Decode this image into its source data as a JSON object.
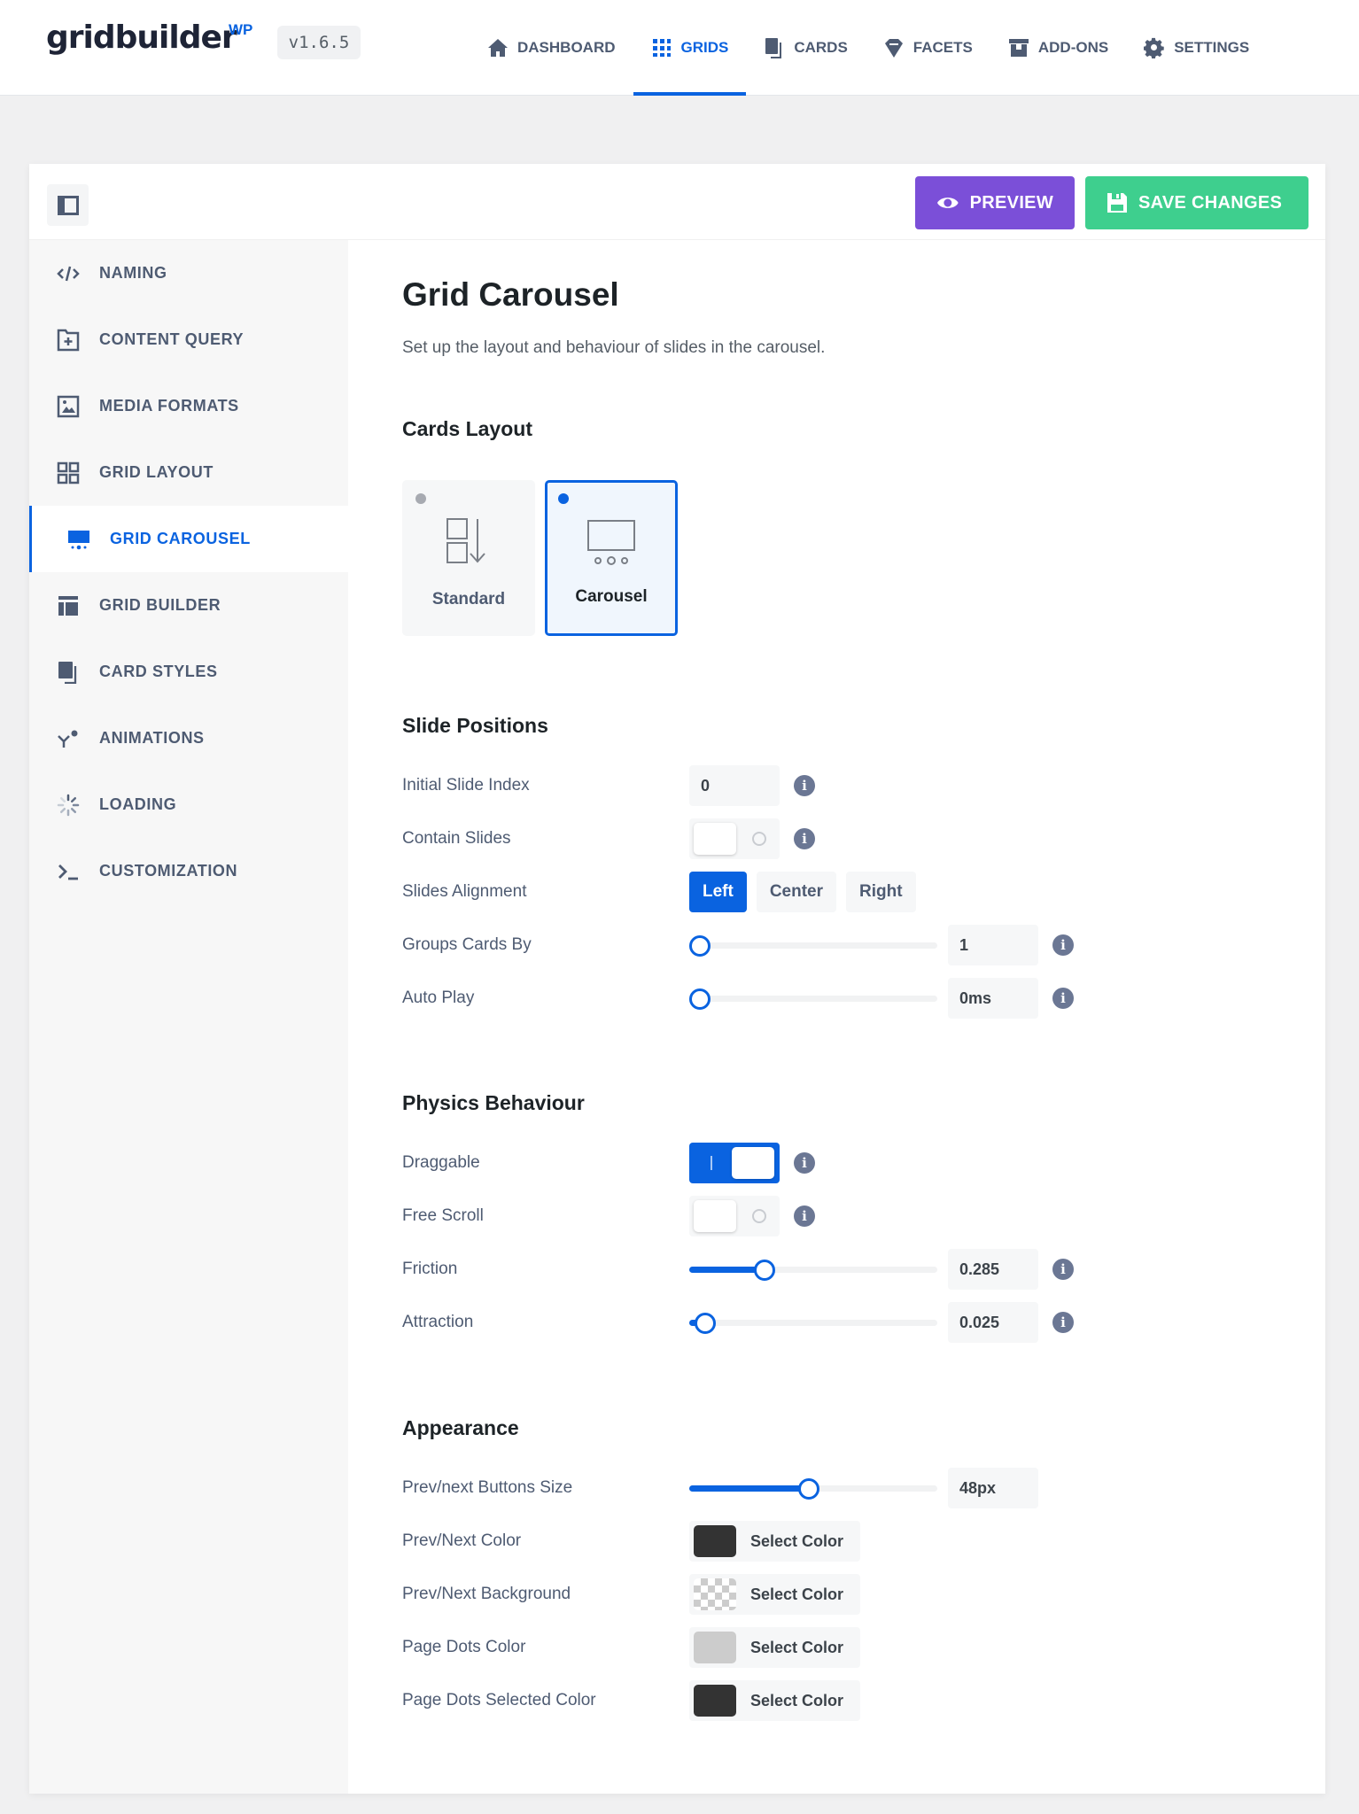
{
  "brand": {
    "logo_text": "gridbuilder",
    "logo_sup": "WP",
    "version": "v1.6.5"
  },
  "nav": [
    {
      "label": "DASHBOARD",
      "icon": "home-icon",
      "active": false
    },
    {
      "label": "GRIDS",
      "icon": "grid-dots-icon",
      "active": true
    },
    {
      "label": "CARDS",
      "icon": "cards-icon",
      "active": false
    },
    {
      "label": "FACETS",
      "icon": "diamond-icon",
      "active": false
    },
    {
      "label": "ADD-ONS",
      "icon": "box-icon",
      "active": false
    },
    {
      "label": "SETTINGS",
      "icon": "gear-icon",
      "active": false
    }
  ],
  "toolbar": {
    "preview_label": "PREVIEW",
    "save_label": "SAVE CHANGES"
  },
  "colors": {
    "accent": "#0a63e0",
    "preview": "#7b4fd8",
    "save": "#3ecf8e"
  },
  "sidebar": {
    "items": [
      {
        "label": "NAMING",
        "icon": "code-icon"
      },
      {
        "label": "CONTENT QUERY",
        "icon": "folder-plus-icon"
      },
      {
        "label": "MEDIA FORMATS",
        "icon": "image-icon"
      },
      {
        "label": "GRID LAYOUT",
        "icon": "grid-layout-icon"
      },
      {
        "label": "GRID CAROUSEL",
        "icon": "carousel-icon",
        "active": true
      },
      {
        "label": "GRID BUILDER",
        "icon": "builder-icon"
      },
      {
        "label": "CARD STYLES",
        "icon": "card-styles-icon"
      },
      {
        "label": "ANIMATIONS",
        "icon": "animation-icon"
      },
      {
        "label": "LOADING",
        "icon": "spinner-icon"
      },
      {
        "label": "CUSTOMIZATION",
        "icon": "terminal-icon"
      }
    ]
  },
  "main": {
    "title": "Grid Carousel",
    "description": "Set up the layout and behaviour of slides in the carousel.",
    "cards_layout": {
      "title": "Cards Layout",
      "options": [
        {
          "label": "Standard",
          "selected": false
        },
        {
          "label": "Carousel",
          "selected": true
        }
      ]
    },
    "slide_positions": {
      "title": "Slide Positions",
      "initial_slide_index": {
        "label": "Initial Slide Index",
        "value": "0"
      },
      "contain_slides": {
        "label": "Contain Slides",
        "on": false
      },
      "slides_alignment": {
        "label": "Slides Alignment",
        "options": [
          "Left",
          "Center",
          "Right"
        ],
        "selected": "Left"
      },
      "groups_cards_by": {
        "label": "Groups Cards By",
        "value": "1",
        "fraction": 0.0
      },
      "auto_play": {
        "label": "Auto Play",
        "value": "0ms",
        "fraction": 0.0
      }
    },
    "physics": {
      "title": "Physics Behaviour",
      "draggable": {
        "label": "Draggable",
        "on": true
      },
      "free_scroll": {
        "label": "Free Scroll",
        "on": false
      },
      "friction": {
        "label": "Friction",
        "value": "0.285",
        "fraction": 0.285
      },
      "attraction": {
        "label": "Attraction",
        "value": "0.025",
        "fraction": 0.025
      }
    },
    "appearance": {
      "title": "Appearance",
      "buttons_size": {
        "label": "Prev/next Buttons Size",
        "value": "48px",
        "fraction": 0.48
      },
      "colors": [
        {
          "label": "Prev/Next Color",
          "button": "Select Color",
          "swatch": "#333333"
        },
        {
          "label": "Prev/Next Background",
          "button": "Select Color",
          "swatch": "transparent"
        },
        {
          "label": "Page Dots Color",
          "button": "Select Color",
          "swatch": "#cccccc"
        },
        {
          "label": "Page Dots Selected Color",
          "button": "Select Color",
          "swatch": "#333333"
        }
      ]
    }
  }
}
